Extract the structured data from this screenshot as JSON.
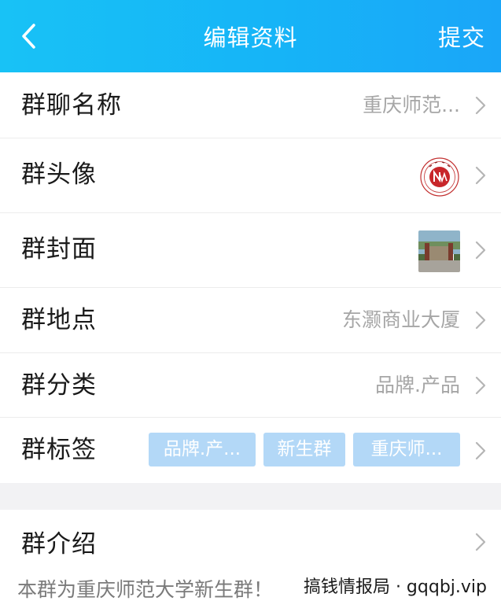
{
  "header": {
    "title": "编辑资料",
    "submit_label": "提交"
  },
  "rows": {
    "name": {
      "label": "群聊名称",
      "value": "重庆师范..."
    },
    "avatar": {
      "label": "群头像"
    },
    "cover": {
      "label": "群封面"
    },
    "location": {
      "label": "群地点",
      "value": "东灏商业大厦"
    },
    "category": {
      "label": "群分类",
      "value": "品牌.产品"
    },
    "tags": {
      "label": "群标签",
      "items": [
        "品牌.产...",
        "新生群",
        "重庆师..."
      ]
    },
    "intro": {
      "label": "群介绍",
      "text": "本群为重庆师范大学新生群！"
    }
  },
  "watermark": "搞钱情报局 · gqqbj.vip",
  "colors": {
    "header_start": "#18c2f6",
    "header_end": "#1aa6f8",
    "tag_bg": "#b3d8f7",
    "separator_bg": "#f2f2f4",
    "value_text": "#a6a6a6"
  },
  "icons": {
    "back": "chevron-left-icon",
    "row_arrow": "chevron-right-icon"
  }
}
